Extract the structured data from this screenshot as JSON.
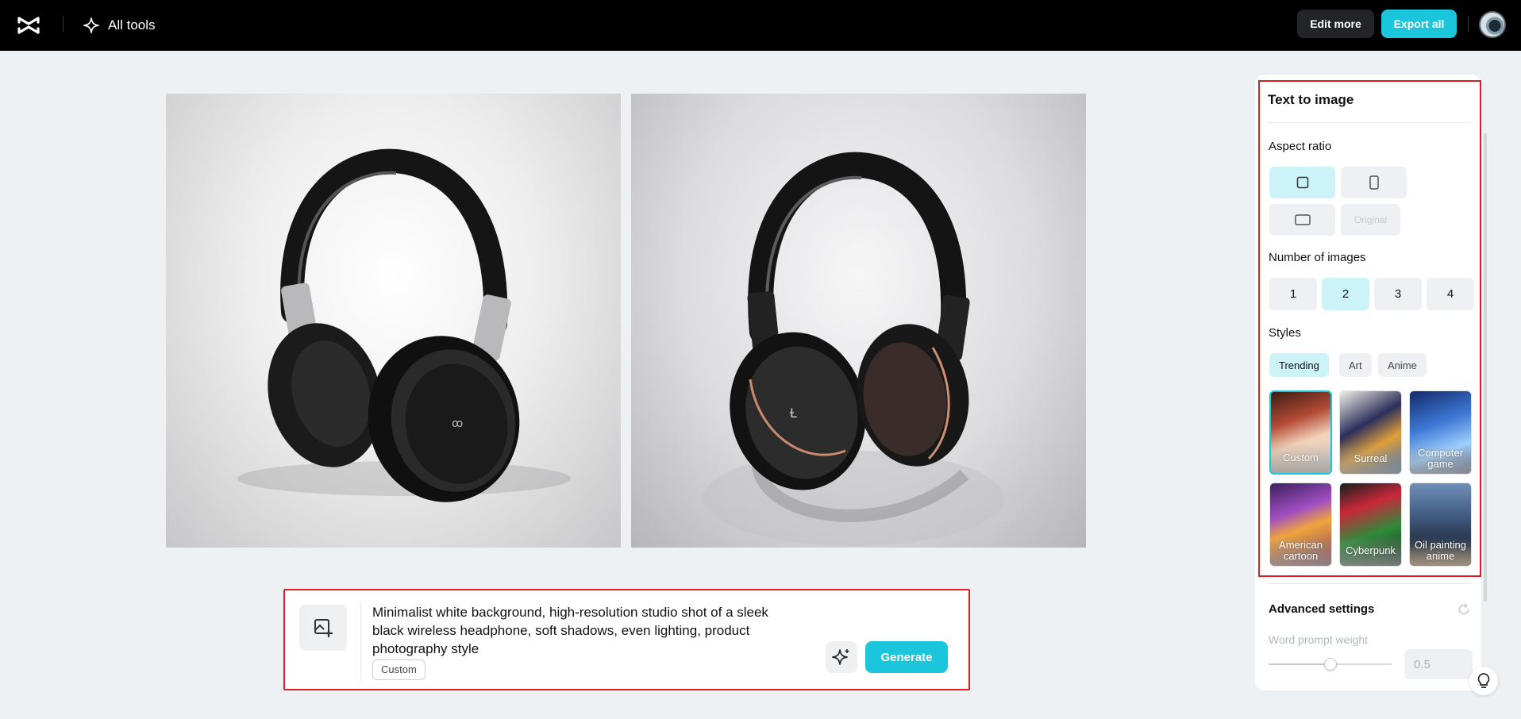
{
  "topbar": {
    "logo_icon": "capcut-logo",
    "all_tools_label": "All tools",
    "edit_more_label": "Edit more",
    "export_all_label": "Export all"
  },
  "images": [
    {
      "subject": "black over-ear headphones, white studio background"
    },
    {
      "subject": "black headphones with copper accents, reflective surface"
    }
  ],
  "prompt": {
    "text": "Minimalist white background, high-resolution studio shot of a sleek black wireless headphone, soft shadows, even lighting, product photography style",
    "style_chip": "Custom",
    "generate_label": "Generate"
  },
  "panel": {
    "title": "Text to image",
    "aspect_ratio": {
      "label": "Aspect ratio",
      "original_label": "Original",
      "selected": "square"
    },
    "number_of_images": {
      "label": "Number of images",
      "options": [
        "1",
        "2",
        "3",
        "4"
      ],
      "selected": "2"
    },
    "styles": {
      "label": "Styles",
      "tabs": [
        "Trending",
        "Art",
        "Anime"
      ],
      "selected_tab": "Trending",
      "items": [
        "Custom",
        "Surreal",
        "Computer game",
        "American cartoon",
        "Cyberpunk",
        "Oil painting anime"
      ],
      "selected_item": "Custom"
    },
    "advanced": {
      "label": "Advanced settings",
      "word_prompt_weight_label": "Word prompt weight",
      "word_prompt_weight_value": "0.5",
      "slider_fraction": 0.5
    }
  },
  "colors": {
    "accent": "#1bc6dd",
    "highlight_border": "#e01b24",
    "selected_bg": "#cbf3f8"
  }
}
